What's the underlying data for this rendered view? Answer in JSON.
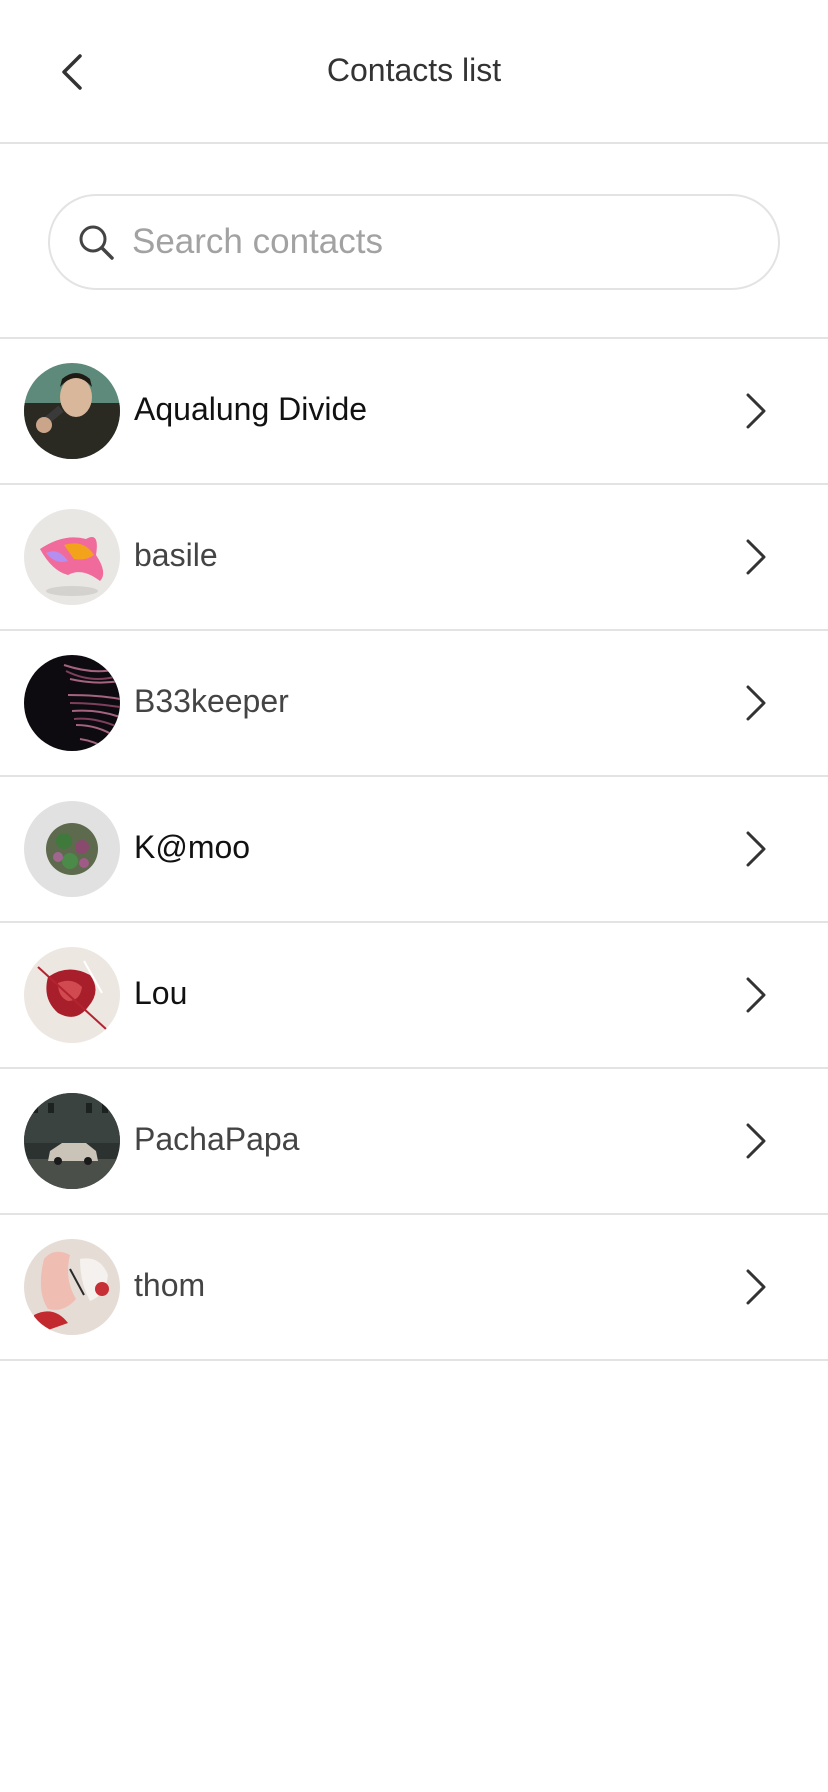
{
  "header": {
    "title": "Contacts list"
  },
  "search": {
    "placeholder": "Search contacts",
    "value": ""
  },
  "contacts": [
    {
      "name": "Aqualung Divide"
    },
    {
      "name": "basile"
    },
    {
      "name": "B33keeper"
    },
    {
      "name": "K@moo"
    },
    {
      "name": "Lou"
    },
    {
      "name": "PachaPapa"
    },
    {
      "name": "thom"
    }
  ],
  "colors": {
    "divider": "#e3e3e3",
    "text": "#333333",
    "placeholder": "#a2a2a2"
  }
}
